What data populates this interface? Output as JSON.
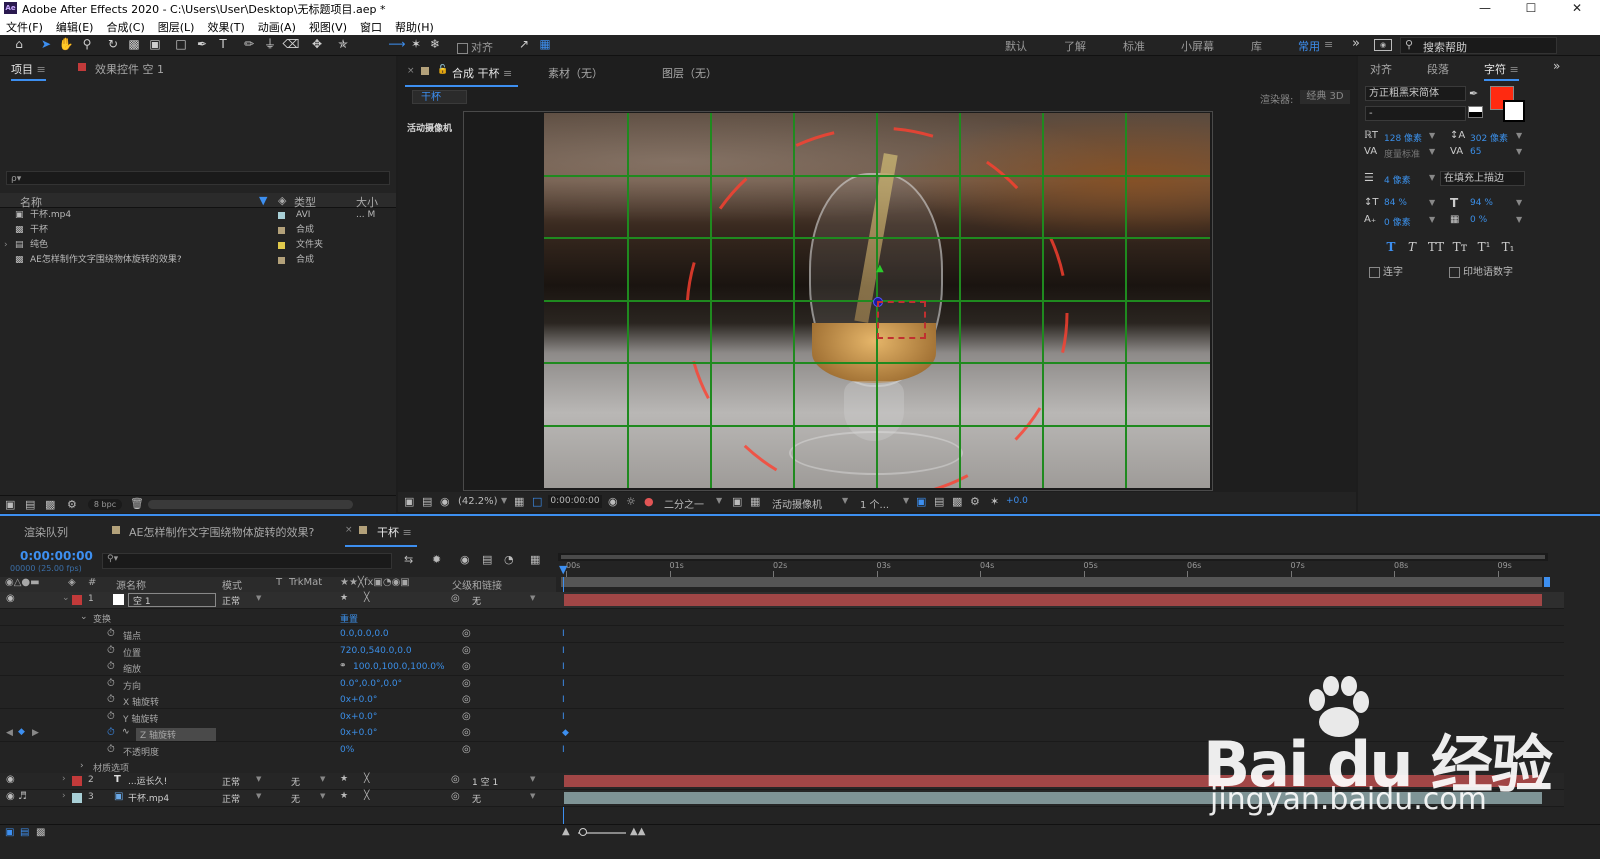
{
  "title_bar": {
    "app_icon": "Ae",
    "title": "Adobe After Effects 2020 - C:\\Users\\User\\Desktop\\无标题项目.aep *"
  },
  "menu": [
    "文件(F)",
    "编辑(E)",
    "合成(C)",
    "图层(L)",
    "效果(T)",
    "动画(A)",
    "视图(V)",
    "窗口",
    "帮助(H)"
  ],
  "toolbar": {
    "snap_label": "对齐",
    "workspaces": [
      "默认",
      "了解",
      "标准",
      "小屏幕",
      "库",
      "常用"
    ],
    "active_workspace": "常用",
    "search_placeholder": "搜索帮助"
  },
  "project_panel": {
    "tab_project": "项目",
    "tab_effects": "效果控件 空 1",
    "search_placeholder": "ρ▾",
    "headers": {
      "name": "名称",
      "type": "类型",
      "size": "大小"
    },
    "items": [
      {
        "name": "干杯.mp4",
        "type": "AVI",
        "size": "... M",
        "label_color": "#a8cfd6"
      },
      {
        "name": "干杯",
        "type": "合成",
        "size": "",
        "label_color": "#b3a17a"
      },
      {
        "name": "纯色",
        "type": "文件夹",
        "size": "",
        "label_color": "#e0c94b"
      },
      {
        "name": "AE怎样制作文字围绕物体旋转的效果?",
        "type": "合成",
        "size": "",
        "label_color": "#b3a17a"
      }
    ],
    "bpc": "8 bpc"
  },
  "comp_panel": {
    "tab_comp": "合成 干杯",
    "tab_footage": "素材（无）",
    "tab_layer": "图层（无）",
    "breadcrumb": "干杯",
    "renderer_label": "渲染器:",
    "renderer_value": "经典 3D",
    "camera_label": "活动摄像机",
    "footer": {
      "zoom": "(42.2%)",
      "timecode": "0:00:00:00",
      "resolution": "二分之一",
      "view": "活动摄像机",
      "views_count": "1 个...",
      "exposure": "+0.0"
    }
  },
  "character_panel": {
    "tab_align": "对齐",
    "tab_paragraph": "段落",
    "tab_character": "字符",
    "font_family": "方正粗黑宋简体",
    "font_style": "-",
    "fill_color": "#ff2a10",
    "font_size": "128 像素",
    "leading": "302 像素",
    "kerning": "度量标准",
    "tracking": "65",
    "stroke_width": "4 像素",
    "stroke_mode": "在填充上描边",
    "vert_scale": "84 %",
    "horiz_scale": "94 %",
    "baseline_shift": "0 像素",
    "tsume": "0 %",
    "style_buttons": [
      "T",
      "T",
      "TT",
      "Tт",
      "T¹",
      "T₁"
    ],
    "ligatures": "连字",
    "hindi_digits": "印地语数字"
  },
  "timeline": {
    "tab_render": "渲染队列",
    "tab_comp2": "AE怎样制作文字围绕物体旋转的效果?",
    "tab_comp": "干杯",
    "timecode": "0:00:00:00",
    "fps": "00000 (25.00 fps)",
    "col_headers": {
      "source": "源名称",
      "mode": "模式",
      "t": "T",
      "trkmat": "TrkMat",
      "parent": "父级和链接"
    },
    "ruler": [
      "00s",
      "01s",
      "02s",
      "03s",
      "04s",
      "05s",
      "06s",
      "07s",
      "08s",
      "09s"
    ],
    "layers": [
      {
        "num": "1",
        "name": "空 1",
        "mode": "正常",
        "trkmat": "",
        "parent": "无",
        "color": "#c23a3a"
      },
      {
        "num": "2",
        "name": "...运长久!",
        "mode": "正常",
        "trkmat": "无",
        "parent": "1 空 1",
        "color": "#c23a3a"
      },
      {
        "num": "3",
        "name": "干杯.mp4",
        "mode": "正常",
        "trkmat": "无",
        "parent": "无",
        "color": "#a8cfd6"
      }
    ],
    "transform_label": "变换",
    "reset_label": "重置",
    "properties": [
      {
        "name": "锚点",
        "value": "0.0,0.0,0.0"
      },
      {
        "name": "位置",
        "value": "720.0,540.0,0.0"
      },
      {
        "name": "缩放",
        "value": "100.0,100.0,100.0%"
      },
      {
        "name": "方向",
        "value": "0.0°,0.0°,0.0°"
      },
      {
        "name": "X 轴旋转",
        "value": "0x+0.0°"
      },
      {
        "name": "Y 轴旋转",
        "value": "0x+0.0°"
      },
      {
        "name": "Z 轴旋转",
        "value": "0x+0.0°"
      },
      {
        "name": "不透明度",
        "value": "0%"
      }
    ],
    "material_options": "材质选项"
  },
  "watermark": {
    "brand": "Bai du 经验",
    "url": "jingyan.baidu.com"
  }
}
